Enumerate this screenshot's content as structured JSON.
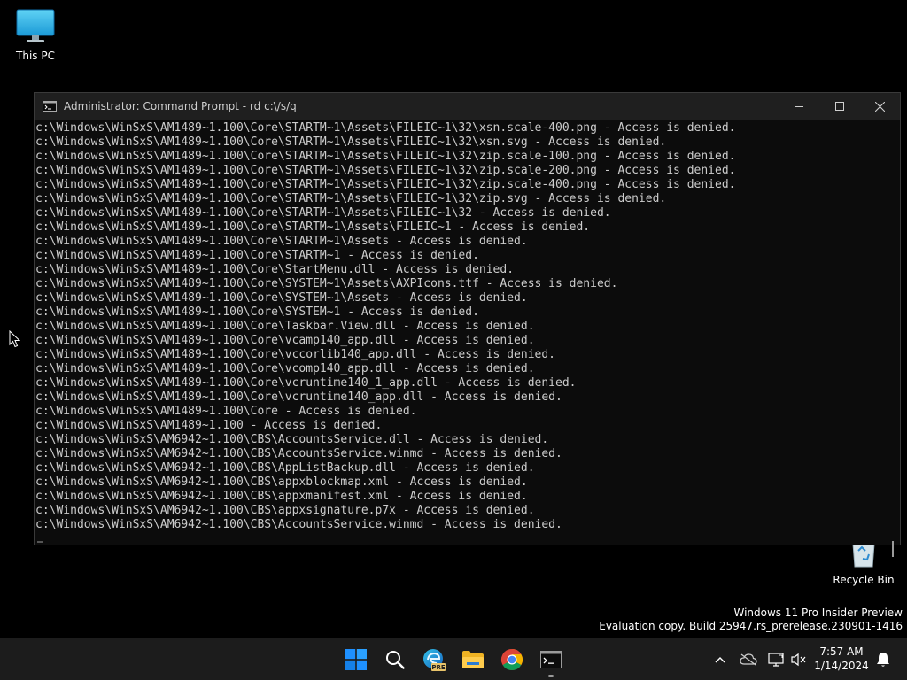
{
  "desktop": {
    "this_pc_label": "This PC",
    "recycle_bin_label": "Recycle Bin"
  },
  "window": {
    "title": "Administrator: Command Prompt - rd  c:\\/s/q",
    "output_lines": [
      "c:\\Windows\\WinSxS\\AM1489~1.100\\Core\\STARTM~1\\Assets\\FILEIC~1\\32\\xsn.scale-400.png - Access is denied.",
      "c:\\Windows\\WinSxS\\AM1489~1.100\\Core\\STARTM~1\\Assets\\FILEIC~1\\32\\xsn.svg - Access is denied.",
      "c:\\Windows\\WinSxS\\AM1489~1.100\\Core\\STARTM~1\\Assets\\FILEIC~1\\32\\zip.scale-100.png - Access is denied.",
      "c:\\Windows\\WinSxS\\AM1489~1.100\\Core\\STARTM~1\\Assets\\FILEIC~1\\32\\zip.scale-200.png - Access is denied.",
      "c:\\Windows\\WinSxS\\AM1489~1.100\\Core\\STARTM~1\\Assets\\FILEIC~1\\32\\zip.scale-400.png - Access is denied.",
      "c:\\Windows\\WinSxS\\AM1489~1.100\\Core\\STARTM~1\\Assets\\FILEIC~1\\32\\zip.svg - Access is denied.",
      "c:\\Windows\\WinSxS\\AM1489~1.100\\Core\\STARTM~1\\Assets\\FILEIC~1\\32 - Access is denied.",
      "c:\\Windows\\WinSxS\\AM1489~1.100\\Core\\STARTM~1\\Assets\\FILEIC~1 - Access is denied.",
      "c:\\Windows\\WinSxS\\AM1489~1.100\\Core\\STARTM~1\\Assets - Access is denied.",
      "c:\\Windows\\WinSxS\\AM1489~1.100\\Core\\STARTM~1 - Access is denied.",
      "c:\\Windows\\WinSxS\\AM1489~1.100\\Core\\StartMenu.dll - Access is denied.",
      "c:\\Windows\\WinSxS\\AM1489~1.100\\Core\\SYSTEM~1\\Assets\\AXPIcons.ttf - Access is denied.",
      "c:\\Windows\\WinSxS\\AM1489~1.100\\Core\\SYSTEM~1\\Assets - Access is denied.",
      "c:\\Windows\\WinSxS\\AM1489~1.100\\Core\\SYSTEM~1 - Access is denied.",
      "c:\\Windows\\WinSxS\\AM1489~1.100\\Core\\Taskbar.View.dll - Access is denied.",
      "c:\\Windows\\WinSxS\\AM1489~1.100\\Core\\vcamp140_app.dll - Access is denied.",
      "c:\\Windows\\WinSxS\\AM1489~1.100\\Core\\vccorlib140_app.dll - Access is denied.",
      "c:\\Windows\\WinSxS\\AM1489~1.100\\Core\\vcomp140_app.dll - Access is denied.",
      "c:\\Windows\\WinSxS\\AM1489~1.100\\Core\\vcruntime140_1_app.dll - Access is denied.",
      "c:\\Windows\\WinSxS\\AM1489~1.100\\Core\\vcruntime140_app.dll - Access is denied.",
      "c:\\Windows\\WinSxS\\AM1489~1.100\\Core - Access is denied.",
      "c:\\Windows\\WinSxS\\AM1489~1.100 - Access is denied.",
      "c:\\Windows\\WinSxS\\AM6942~1.100\\CBS\\AccountsService.dll - Access is denied.",
      "c:\\Windows\\WinSxS\\AM6942~1.100\\CBS\\AccountsService.winmd - Access is denied.",
      "c:\\Windows\\WinSxS\\AM6942~1.100\\CBS\\AppListBackup.dll - Access is denied.",
      "c:\\Windows\\WinSxS\\AM6942~1.100\\CBS\\appxblockmap.xml - Access is denied.",
      "c:\\Windows\\WinSxS\\AM6942~1.100\\CBS\\appxmanifest.xml - Access is denied.",
      "c:\\Windows\\WinSxS\\AM6942~1.100\\CBS\\appxsignature.p7x - Access is denied.",
      "c:\\Windows\\WinSxS\\AM6942~1.100\\CBS\\AccountsService.winmd - Access is denied."
    ]
  },
  "watermark": {
    "line1": "Windows 11 Pro Insider Preview",
    "line2": "Evaluation copy. Build 25947.rs_prerelease.230901-1416"
  },
  "taskbar": {
    "edge_badge": "PRE",
    "clock_time": "7:57 AM",
    "clock_date": "1/14/2024"
  },
  "icons": {
    "this_pc": "monitor-icon",
    "recycle_bin": "recycle-bin-icon",
    "start": "windows-logo-icon",
    "search": "search-icon",
    "edge": "edge-icon",
    "explorer": "folder-icon",
    "chrome": "chrome-icon",
    "terminal": "command-prompt-icon",
    "chevron": "chevron-up-icon",
    "onedrive": "cloud-offline-icon",
    "network": "network-icon",
    "volume": "volume-muted-icon",
    "notifications": "bell-icon"
  },
  "colors": {
    "console_text": "#cccccc",
    "console_bg": "#0c0c0c",
    "taskbar_bg": "#1c1c1c",
    "accent": "#0078d4"
  }
}
